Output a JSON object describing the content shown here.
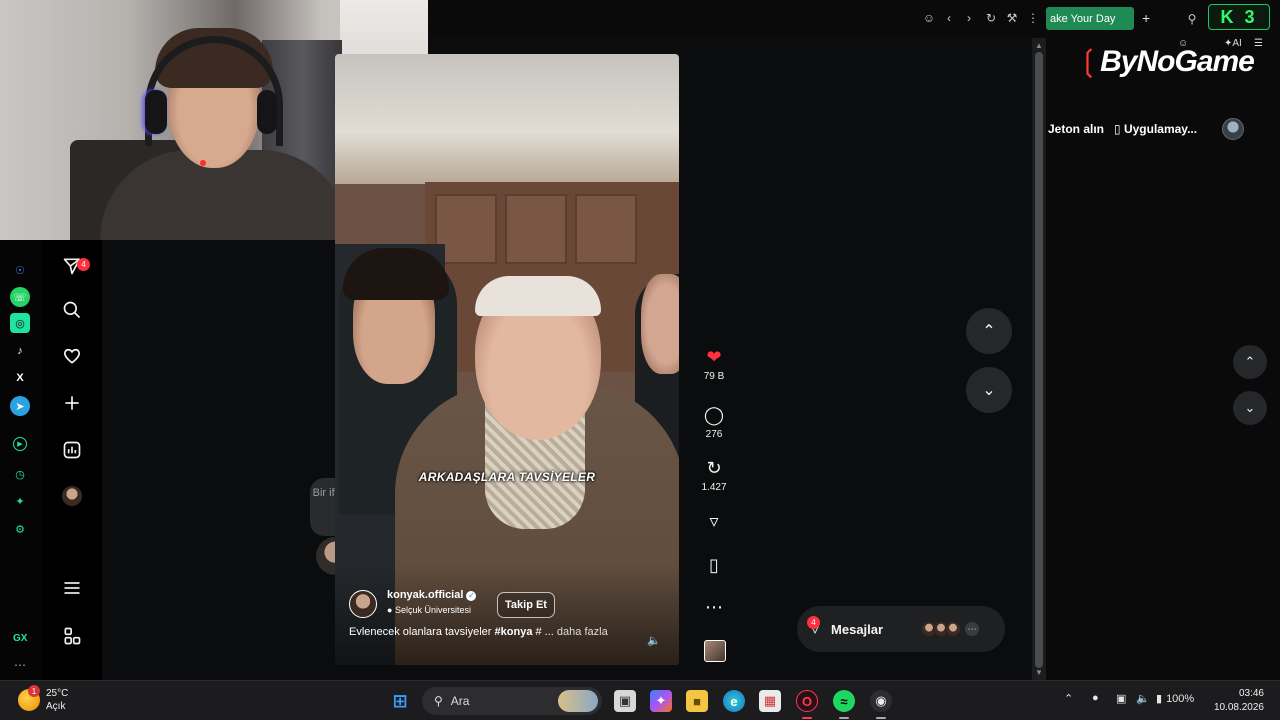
{
  "browser": {
    "active_tab_label": "ake Your Day",
    "gx_logo_text": "K 3"
  },
  "gx_rail": {
    "label": "GX",
    "more": "⋯",
    "apps": [
      {
        "name": "messenger",
        "glyph": "⌁",
        "color": "#3a8bff"
      },
      {
        "name": "whatsapp",
        "glyph": "☎",
        "color": "#25d366"
      },
      {
        "name": "instagram",
        "glyph": "◎",
        "color": "#6f7f8f"
      },
      {
        "name": "tiktok",
        "glyph": "♪",
        "color": "#ffffff"
      },
      {
        "name": "x",
        "glyph": "𝕏",
        "color": "#ffffff"
      },
      {
        "name": "telegram",
        "glyph": "➤",
        "color": "#2aa3e0"
      },
      {
        "name": "player",
        "glyph": "▶",
        "color": "#20e3a0"
      },
      {
        "name": "history",
        "glyph": "◷",
        "color": "#20e3a0"
      },
      {
        "name": "extensions",
        "glyph": "✦",
        "color": "#20e3a0"
      },
      {
        "name": "settings",
        "glyph": "⚙",
        "color": "#20e3a0"
      }
    ]
  },
  "ig_nav": {
    "messages_badge": "4"
  },
  "video": {
    "caption": "ARKADAŞLARA TAVSİYELER",
    "author": "konyak.official",
    "location": "Selçuk Üniversitesi",
    "follow": "Takip Et",
    "description_text": "Evlenecek olanlara tavsiyeler ",
    "description_tag": "#konya",
    "description_rest": " # ... ",
    "description_more": "daha fazla"
  },
  "emoji_prompt": "Bir ifade simgesi bırak...",
  "actions": {
    "likes": "79 B",
    "comments": "276",
    "reposts": "1.427"
  },
  "messages": {
    "label": "Mesajlar",
    "badge": "4"
  },
  "right_panel": {
    "brand": "ByNoGame",
    "ai": "AI",
    "links": [
      "Jeton alın",
      "Uygulamay..."
    ]
  },
  "taskbar": {
    "temperature": "25°C",
    "condition": "Açık",
    "weather_badge": "1",
    "search_placeholder": "Ara",
    "battery": "100%",
    "time": "03:46",
    "date": "10.08.2026"
  },
  "colors": {
    "like": "#ff3040",
    "gx_accent": "#20e3a0",
    "tab_green": "#1f8a54"
  }
}
